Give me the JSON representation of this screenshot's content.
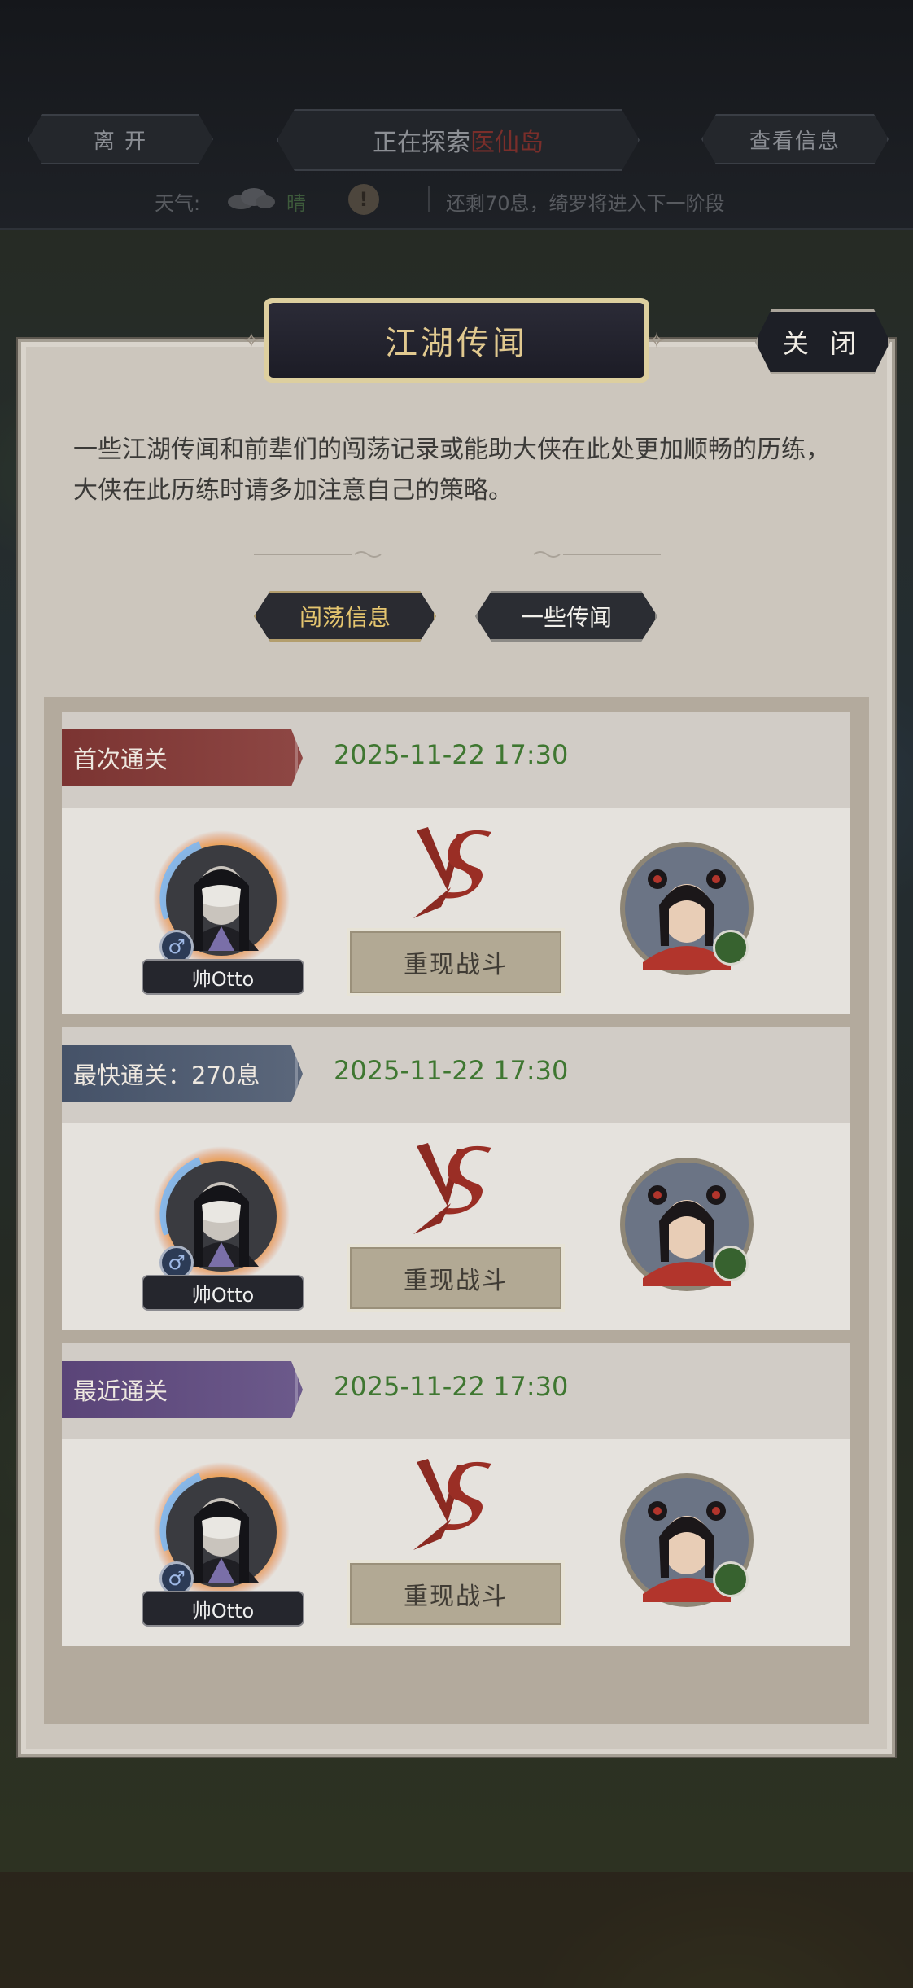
{
  "topbar": {
    "leave_label": "离 开",
    "exploring_prefix": "正在探索",
    "exploring_place": "医仙岛",
    "view_info_label": "查看信息",
    "weather_label": "天气:",
    "weather_value": "晴",
    "remaining_text": "还剩70息，绮罗将进入下一阶段"
  },
  "panel": {
    "title": "江湖传闻",
    "close_label": "关 闭",
    "description": "一些江湖传闻和前辈们的闯荡记录或能助大侠在此处更加顺畅的历练，大侠在此历练时请多加注意自己的策略。",
    "tabs": [
      {
        "label": "闯荡信息",
        "active": true
      },
      {
        "label": "一些传闻",
        "active": false
      }
    ]
  },
  "records": [
    {
      "badge": "首次通关",
      "badge_color": "#7b3432",
      "date": "2025-11-22 17:30",
      "player_name": "帅Otto",
      "replay_label": "重现战斗"
    },
    {
      "badge": "最快通关：270息",
      "badge_color": "#455268",
      "date": "2025-11-22 17:30",
      "player_name": "帅Otto",
      "replay_label": "重现战斗"
    },
    {
      "badge": "最近通关",
      "badge_color": "#5a4478",
      "date": "2025-11-22 17:30",
      "player_name": "帅Otto",
      "replay_label": "重现战斗"
    }
  ],
  "colors": {
    "date_green": "#3f7731",
    "tab_gold": "#e4c56f",
    "title_gold": "#e1c98f"
  }
}
